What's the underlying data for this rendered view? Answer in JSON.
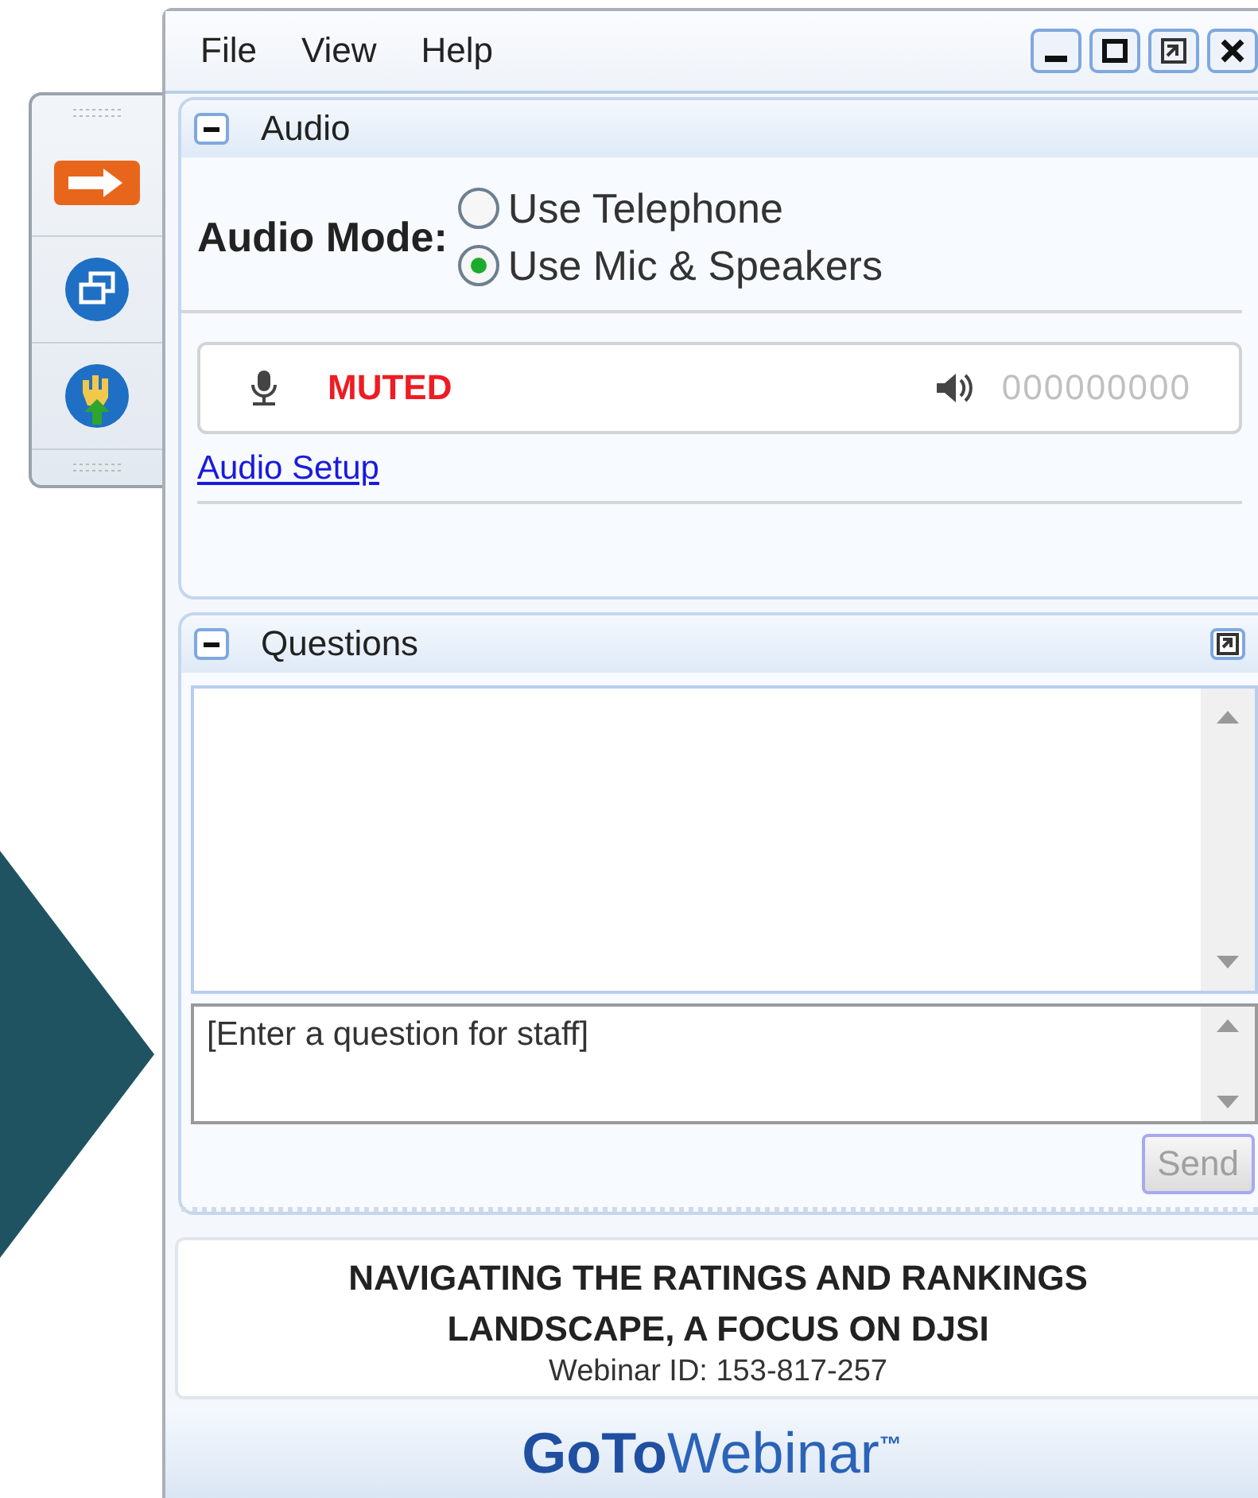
{
  "menu": [
    {
      "label": "File"
    },
    {
      "label": "View"
    },
    {
      "label": "Help"
    }
  ],
  "audio": {
    "title": "Audio",
    "expanded": true,
    "mode_label": "Audio Mode:",
    "options": [
      {
        "label": "Use Telephone",
        "selected": false
      },
      {
        "label": "Use Mic & Speakers",
        "selected": true
      }
    ],
    "mic_status": "MUTED",
    "speaker_reading": "000000000",
    "setup_link": "Audio Setup"
  },
  "questions": {
    "title": "Questions",
    "expanded": true,
    "placeholder": "[Enter a question for staff]",
    "send": {
      "label": "Send",
      "disabled": true
    }
  },
  "webinar": {
    "title_lines": [
      "NAVIGATING THE RATINGS AND RANKINGS",
      "LANDSCAPE, A FOCUS ON DJSI"
    ],
    "id": "Webinar ID: 153-817-257"
  },
  "logo": "**GoTo**Webinar$^{™}$"
}
